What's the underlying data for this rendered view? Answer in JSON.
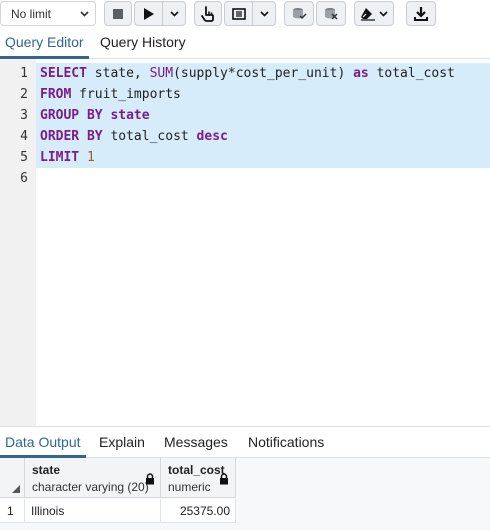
{
  "toolbar": {
    "limit_select_value": "No limit",
    "icons": [
      "stop-icon",
      "execute-icon",
      "chevron-down-icon",
      "explain-icon",
      "explain-options-icon",
      "commit-icon",
      "rollback-icon",
      "clear-icon",
      "download-icon"
    ]
  },
  "editor_tabs": [
    {
      "label": "Query Editor",
      "active": true
    },
    {
      "label": "Query History",
      "active": false
    }
  ],
  "editor": {
    "line_numbers": [
      "1",
      "2",
      "3",
      "4",
      "5",
      "6"
    ]
  },
  "output_tabs": [
    {
      "label": "Data Output",
      "active": true
    },
    {
      "label": "Explain",
      "active": false
    },
    {
      "label": "Messages",
      "active": false
    },
    {
      "label": "Notifications",
      "active": false
    }
  ],
  "results": {
    "columns": [
      {
        "name": "state",
        "type": "character varying (20)"
      },
      {
        "name": "total_cost",
        "type": "numeric"
      }
    ],
    "rows": [
      {
        "row_number": "1",
        "values": [
          "Illinois",
          "25375.00"
        ]
      }
    ]
  },
  "colors": {
    "accent": "#326690",
    "keyword": "#7a1d8a",
    "number": "#a2581c",
    "selection": "#d6ecfa",
    "gutter": "#f1f1f1"
  }
}
